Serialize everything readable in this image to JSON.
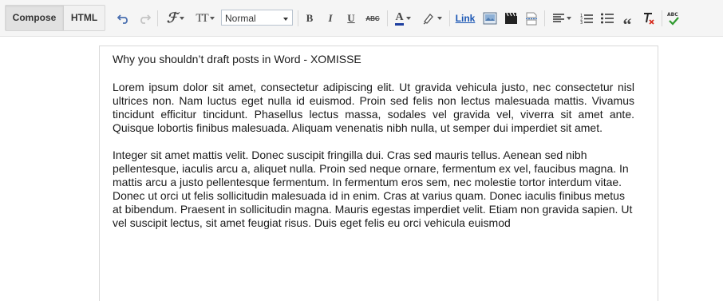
{
  "toolbar": {
    "compose_label": "Compose",
    "html_label": "HTML",
    "format_value": "Normal",
    "link_label": "Link",
    "text_size_label": "TT",
    "icons": [
      "undo-icon",
      "redo-icon",
      "font-family-icon",
      "text-size-icon",
      "bold-icon",
      "italic-icon",
      "underline-icon",
      "strikethrough-icon",
      "text-color-icon",
      "highlight-color-icon",
      "link-icon",
      "insert-image-icon",
      "insert-video-icon",
      "insert-jump-break-icon",
      "align-icon",
      "numbered-list-icon",
      "bulleted-list-icon",
      "quote-icon",
      "remove-formatting-icon",
      "spell-check-icon"
    ]
  },
  "editor": {
    "title": "Why you shouldn’t draft posts in Word - XOMISSE",
    "paragraphs": [
      "Lorem ipsum dolor sit amet, consectetur adipiscing elit. Ut gravida vehicula justo, nec consectetur nisl ultrices non. Nam luctus eget nulla id euismod. Proin sed felis non lectus malesuada mattis. Vivamus tincidunt efficitur tincidunt. Phasellus lectus massa, sodales vel gravida vel, viverra sit amet ante. Quisque lobortis finibus malesuada. Aliquam venenatis nibh nulla, ut semper dui imperdiet sit amet.",
      "Integer sit amet mattis velit. Donec suscipit fringilla dui. Cras sed mauris tellus. Aenean sed nibh pellentesque, iaculis arcu a, aliquet nulla. Proin sed neque ornare, fermentum ex vel, faucibus magna. In mattis arcu a justo pellentesque fermentum. In fermentum eros sem, nec molestie tortor interdum vitae. Donec ut orci ut felis sollicitudin malesuada id in enim. Cras at varius quam. Donec iaculis finibus metus at bibendum. Praesent in sollicitudin magna. Mauris egestas imperdiet velit. Etiam non gravida sapien. Ut vel suscipit lectus, sit amet feugiat risus. Duis eget felis eu orci vehicula euismod"
    ]
  },
  "colors": {
    "toolbar_bg": "#f5f5f5",
    "link_blue": "#1a56b4",
    "text_color_underline": "#1e3fa0",
    "remove_format_red": "#d62b1e",
    "spellcheck_green": "#2f9a2f"
  }
}
